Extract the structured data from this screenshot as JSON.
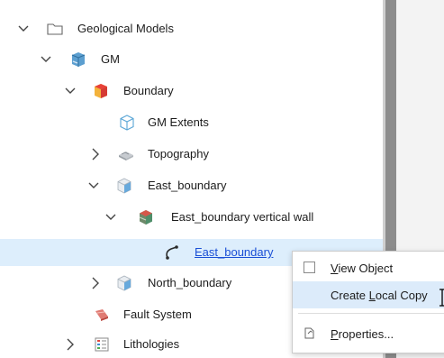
{
  "tree": {
    "items": [
      {
        "label": "Geological Models",
        "icon": "folder-icon",
        "expanded": true
      },
      {
        "label": "GM",
        "icon": "geological-model-icon",
        "expanded": true
      },
      {
        "label": "Boundary",
        "icon": "boundary-icon",
        "expanded": true
      },
      {
        "label": "GM Extents",
        "icon": "extents-box-icon"
      },
      {
        "label": "Topography",
        "icon": "topography-icon",
        "expanded": false
      },
      {
        "label": "East_boundary",
        "icon": "boundary-surface-icon",
        "expanded": true
      },
      {
        "label": "East_boundary vertical wall",
        "icon": "vertical-wall-icon",
        "expanded": true
      },
      {
        "label": "East_boundary",
        "icon": "polyline-icon",
        "selected": true
      },
      {
        "label": "North_boundary",
        "icon": "boundary-surface-icon",
        "expanded": false
      },
      {
        "label": "Fault System",
        "icon": "fault-system-icon"
      },
      {
        "label": "Lithologies",
        "icon": "lithologies-list-icon",
        "expanded": false
      }
    ]
  },
  "context_menu": {
    "items": [
      {
        "label": "View Object",
        "mnemonic": "V",
        "icon": "checkbox-icon"
      },
      {
        "label": "Create Local Copy",
        "mnemonic": "L",
        "highlighted": true
      },
      {
        "label": "Properties...",
        "mnemonic": "P",
        "icon": "properties-icon"
      }
    ]
  },
  "colors": {
    "selection_bg": "#ddeefc",
    "menu_highlight": "#dcebfa",
    "link": "#1a4fd6",
    "splitter": "#8d8d8d"
  }
}
